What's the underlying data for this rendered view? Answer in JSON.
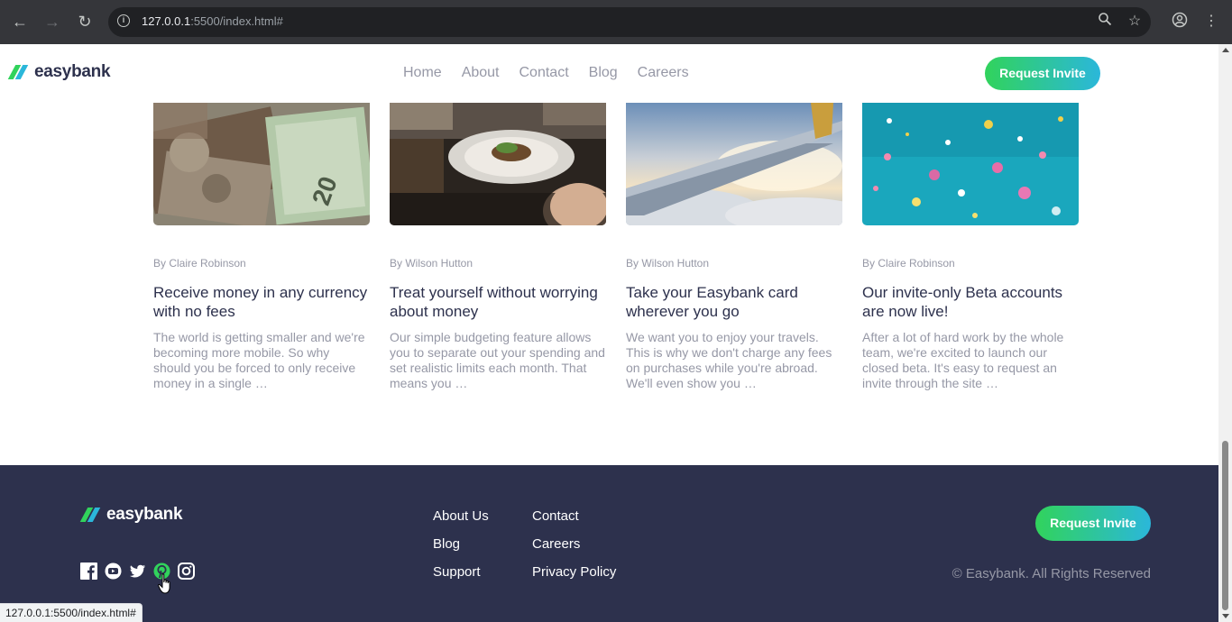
{
  "browser": {
    "url_host": "127.0.0.1",
    "url_rest": ":5500/index.html#",
    "status_url": "127.0.0.1:5500/index.html#"
  },
  "header": {
    "logo": "easybank",
    "nav": [
      "Home",
      "About",
      "Contact",
      "Blog",
      "Careers"
    ],
    "cta": "Request Invite"
  },
  "articles": [
    {
      "author": "By Claire Robinson",
      "title": "Receive money in any currency with no fees",
      "excerpt": "The world is getting smaller and we're becoming more mobile. So why should you be forced to only receive money in a single …"
    },
    {
      "author": "By Wilson Hutton",
      "title": "Treat yourself without worrying about money",
      "excerpt": "Our simple budgeting feature allows you to separate out your spending and set realistic limits each month. That means you …"
    },
    {
      "author": "By Wilson Hutton",
      "title": "Take your Easybank card wherever you go",
      "excerpt": "We want you to enjoy your travels. This is why we don't charge any fees on purchases while you're abroad. We'll even show you …"
    },
    {
      "author": "By Claire Robinson",
      "title": "Our invite-only Beta accounts are now live!",
      "excerpt": "After a lot of hard work by the whole team, we're excited to launch our closed beta. It's easy to request an invite through the site …"
    }
  ],
  "footer": {
    "logo": "easybank",
    "links": [
      "About Us",
      "Contact",
      "Blog",
      "Careers",
      "Support",
      "Privacy Policy"
    ],
    "cta": "Request Invite",
    "copyright": "© Easybank. All Rights Reserved",
    "socials": [
      "facebook-icon",
      "youtube-icon",
      "twitter-icon",
      "pinterest-icon",
      "instagram-icon"
    ]
  },
  "colors": {
    "dark_blue": "#2d314d",
    "grayish_blue": "#9698a6",
    "lime": "#31d35c",
    "cyan": "#2bb7da",
    "hover_social": "#31d35c"
  }
}
